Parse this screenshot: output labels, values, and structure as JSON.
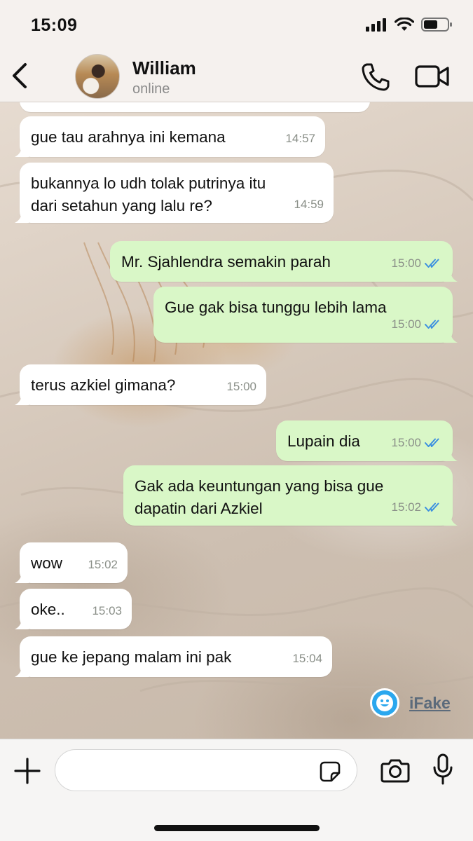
{
  "status_bar": {
    "time": "15:09",
    "icons": [
      "signal-icon",
      "wifi-icon",
      "battery-icon"
    ]
  },
  "header": {
    "back_icon": "chevron-left-icon",
    "contact_name": "William",
    "contact_status": "online",
    "call_icon": "phone-icon",
    "video_icon": "video-camera-icon"
  },
  "messages": [
    {
      "direction": "in",
      "lines": [
        "gue tau arahnya ini kemana"
      ],
      "time": "14:57"
    },
    {
      "direction": "in",
      "lines": [
        "bukannya lo udh tolak putrinya itu",
        "dari setahun yang lalu re?"
      ],
      "time": "14:59"
    },
    {
      "direction": "out",
      "lines": [
        "Mr. Sjahlendra semakin parah"
      ],
      "time": "15:00",
      "read": true
    },
    {
      "direction": "out",
      "lines": [
        "Gue gak bisa tunggu lebih lama"
      ],
      "time": "15:00",
      "read": true
    },
    {
      "direction": "in",
      "lines": [
        "terus azkiel gimana?"
      ],
      "time": "15:00"
    },
    {
      "direction": "out",
      "lines": [
        "Lupain dia"
      ],
      "time": "15:00",
      "read": true
    },
    {
      "direction": "out",
      "lines": [
        "Gak ada keuntungan yang bisa gue",
        "dapatin dari Azkiel"
      ],
      "time": "15:02",
      "read": true
    },
    {
      "direction": "in",
      "lines": [
        "wow"
      ],
      "time": "15:02"
    },
    {
      "direction": "in",
      "lines": [
        "oke.."
      ],
      "time": "15:03"
    },
    {
      "direction": "in",
      "lines": [
        "gue ke jepang malam ini pak"
      ],
      "time": "15:04"
    }
  ],
  "watermark": {
    "label": "iFake",
    "icon": "smiley-icon"
  },
  "input_bar": {
    "plus_icon": "plus-icon",
    "placeholder": "",
    "sticker_icon": "sticker-icon",
    "camera_icon": "camera-icon",
    "mic_icon": "microphone-icon"
  },
  "colors": {
    "incoming_bubble": "#ffffff",
    "outgoing_bubble": "#d9f7c7",
    "read_ticks": "#3b8fe0",
    "header_bg": "#f5f1ee"
  }
}
